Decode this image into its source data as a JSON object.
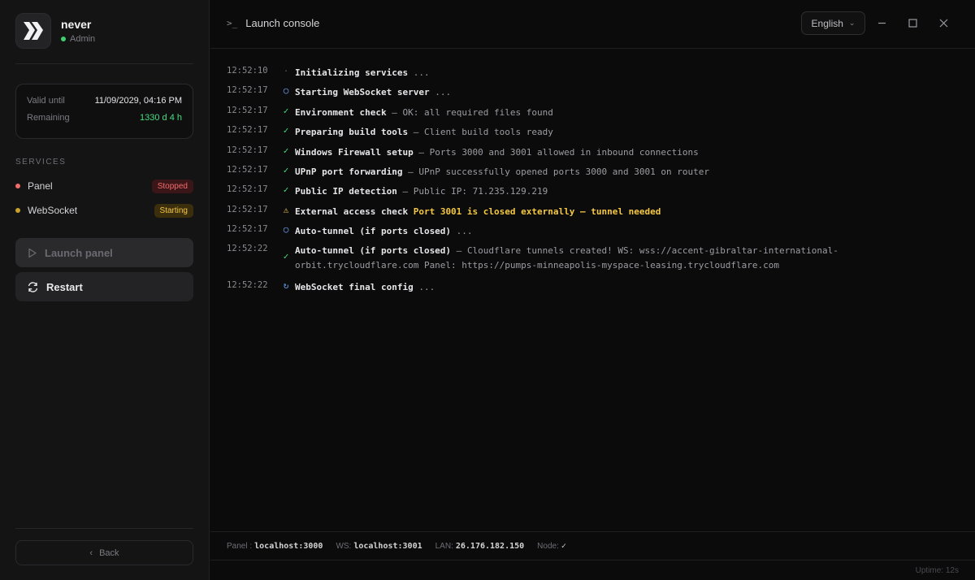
{
  "sidebar": {
    "username": "never",
    "role": "Admin",
    "license": {
      "valid_label": "Valid until",
      "valid_value": "11/09/2029, 04:16 PM",
      "remaining_label": "Remaining",
      "remaining_value": "1330 d 4 h"
    },
    "services_label": "SERVICES",
    "services": [
      {
        "name": "Panel",
        "status": "Stopped",
        "color": "#f26b6b"
      },
      {
        "name": "WebSocket",
        "status": "Starting",
        "color": "#c9a227"
      }
    ],
    "launch_label": "Launch panel",
    "restart_label": "Restart",
    "back_label": "Back"
  },
  "topbar": {
    "title": "Launch console",
    "prompt_glyph": ">_",
    "language": "English"
  },
  "console": [
    {
      "time": "12:52:10",
      "icon": "dot",
      "title": "Initializing services",
      "sep": "",
      "detail": "",
      "suffix": " ..."
    },
    {
      "time": "12:52:17",
      "icon": "pending",
      "title": "Starting WebSocket server",
      "sep": "",
      "detail": "",
      "suffix": " ..."
    },
    {
      "time": "12:52:17",
      "icon": "ok",
      "title": "Environment check",
      "sep": " — ",
      "detail": "OK: all required files found",
      "suffix": ""
    },
    {
      "time": "12:52:17",
      "icon": "ok",
      "title": "Preparing build tools",
      "sep": " — ",
      "detail": "Client build tools ready",
      "suffix": ""
    },
    {
      "time": "12:52:17",
      "icon": "ok",
      "title": "Windows Firewall setup",
      "sep": " — ",
      "detail": "Ports 3000 and 3001 allowed in inbound connections",
      "suffix": ""
    },
    {
      "time": "12:52:17",
      "icon": "ok",
      "title": "UPnP port forwarding",
      "sep": " — ",
      "detail": "UPnP successfully opened ports 3000 and 3001 on router",
      "suffix": ""
    },
    {
      "time": "12:52:17",
      "icon": "ok",
      "title": "Public IP detection",
      "sep": " — ",
      "detail": "Public IP: 71.235.129.219",
      "suffix": ""
    },
    {
      "time": "12:52:17",
      "icon": "warn",
      "title": "External access check",
      "sep": " ",
      "detail": "Port 3001 is closed externally — tunnel needed",
      "suffix": ""
    },
    {
      "time": "12:52:17",
      "icon": "pending",
      "title": "Auto-tunnel (if ports closed)",
      "sep": "",
      "detail": "",
      "suffix": " ..."
    },
    {
      "time": "12:52:22",
      "icon": "ok",
      "title": "Auto-tunnel (if ports closed)",
      "sep": " — ",
      "detail": "Cloudflare tunnels created! WS: wss://accent-gibraltar-international-",
      "detail2": "orbit.trycloudflare.com Panel: https://pumps-minneapolis-myspace-leasing.trycloudflare.com",
      "suffix": ""
    },
    {
      "time": "12:52:22",
      "icon": "spin",
      "title": "WebSocket final config",
      "sep": "",
      "detail": "",
      "suffix": " ..."
    }
  ],
  "footer": {
    "panel_label": "Panel :",
    "panel_value": "localhost:3000",
    "ws_label": "WS:",
    "ws_value": "localhost:3001",
    "lan_label": "LAN:",
    "lan_value": "26.176.182.150",
    "node_label": "Node:",
    "node_value": "✓",
    "uptime": "Uptime: 12s"
  }
}
